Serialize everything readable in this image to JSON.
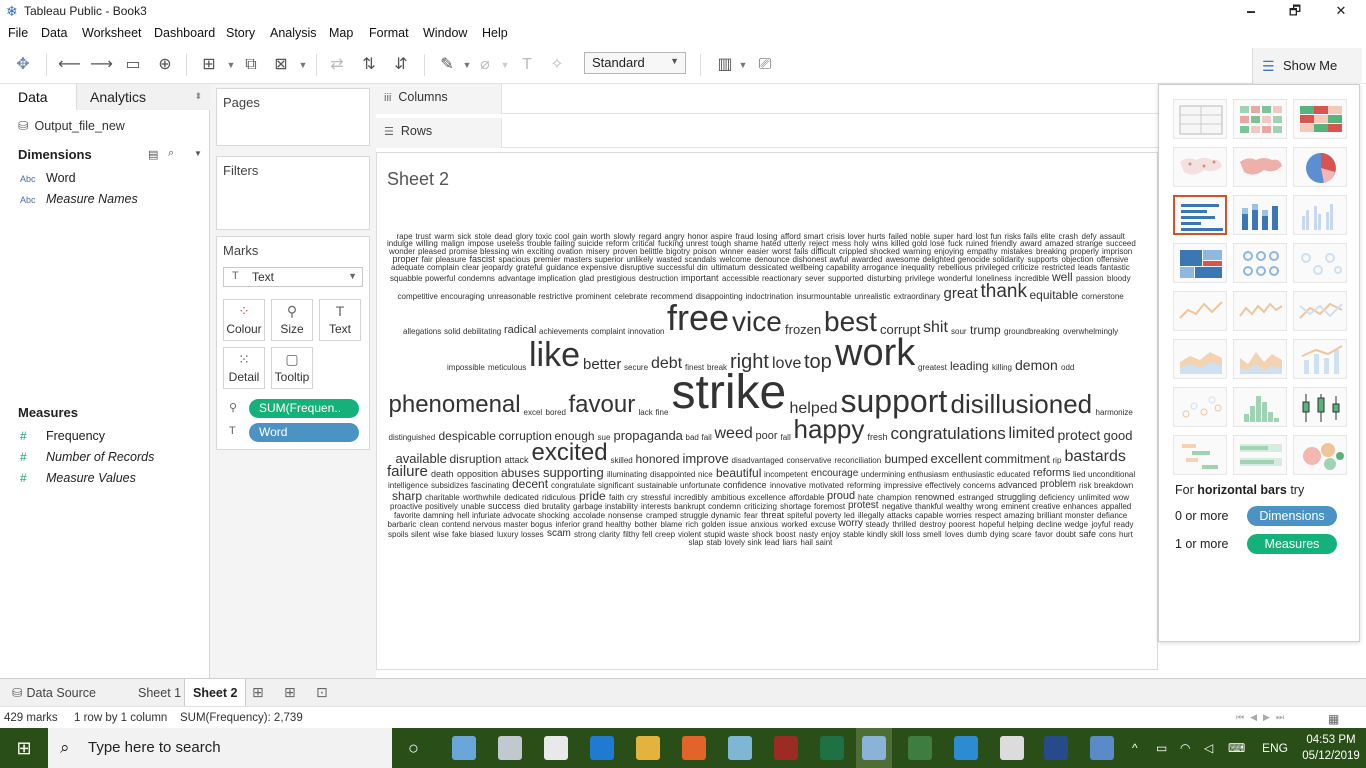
{
  "window": {
    "title": "Tableau Public - Book3",
    "minimize": "🗕",
    "maximize": "🗗",
    "close": "✕"
  },
  "menu": [
    "File",
    "Data",
    "Worksheet",
    "Dashboard",
    "Story",
    "Analysis",
    "Map",
    "Format",
    "Window",
    "Help"
  ],
  "toolbar": {
    "fit_mode": "Standard",
    "show_me_label": "Show Me"
  },
  "data_pane": {
    "tab_data": "Data",
    "tab_analytics": "Analytics",
    "datasource": "Output_file_new",
    "dimensions_header": "Dimensions",
    "dimensions": [
      {
        "type": "Abc",
        "name": "Word",
        "italic": false
      },
      {
        "type": "Abc",
        "name": "Measure Names",
        "italic": true
      }
    ],
    "measures_header": "Measures",
    "measures": [
      {
        "type": "#",
        "name": "Frequency",
        "italic": false
      },
      {
        "type": "#",
        "name": "Number of Records",
        "italic": true
      },
      {
        "type": "#",
        "name": "Measure Values",
        "italic": true
      }
    ]
  },
  "cards": {
    "pages": "Pages",
    "filters": "Filters",
    "marks": "Marks",
    "mark_type": "Text",
    "buttons": [
      {
        "icon": "color-icon",
        "label": "Colour"
      },
      {
        "icon": "size-icon",
        "label": "Size"
      },
      {
        "icon": "text-icon",
        "label": "Text"
      },
      {
        "icon": "detail-icon",
        "label": "Detail"
      },
      {
        "icon": "tooltip-icon",
        "label": "Tooltip"
      }
    ],
    "pills": [
      "SUM(Frequen..",
      "Word"
    ]
  },
  "shelves": {
    "columns": "Columns",
    "rows": "Rows"
  },
  "sheet": {
    "title": "Sheet 2"
  },
  "word_cloud": [
    [
      "rape",
      8
    ],
    [
      "trust",
      8
    ],
    [
      "warm",
      8
    ],
    [
      "sick",
      8
    ],
    [
      "stole",
      8
    ],
    [
      "dead",
      8
    ],
    [
      "glory",
      8
    ],
    [
      "toxic",
      8
    ],
    [
      "cool",
      8
    ],
    [
      "gain",
      8
    ],
    [
      "worth",
      8
    ],
    [
      "slowly",
      8
    ],
    [
      "regard",
      8
    ],
    [
      "angry",
      8
    ],
    [
      "honor",
      8
    ],
    [
      "aspire",
      8
    ],
    [
      "fraud",
      8
    ],
    [
      "losing",
      8
    ],
    [
      "afford",
      8
    ],
    [
      "smart",
      8
    ],
    [
      "crisis",
      8
    ],
    [
      "lover",
      8
    ],
    [
      "hurts",
      8
    ],
    [
      "failed",
      8
    ],
    [
      "noble",
      8
    ],
    [
      "super",
      8
    ],
    [
      "hard",
      8
    ],
    [
      "lost",
      8
    ],
    [
      "fun",
      8
    ],
    [
      "risks",
      8
    ],
    [
      "fails",
      8
    ],
    [
      "elite",
      8
    ],
    [
      "crash",
      8
    ],
    [
      "defy",
      8
    ],
    [
      "assault",
      8
    ],
    [
      "indulge",
      8
    ],
    [
      "willing",
      8
    ],
    [
      "malign",
      8
    ],
    [
      "impose",
      8
    ],
    [
      "useless",
      8
    ],
    [
      "trouble",
      8
    ],
    [
      "failing",
      8
    ],
    [
      "suicide",
      8
    ],
    [
      "reform",
      8
    ],
    [
      "critical",
      8
    ],
    [
      "fucking",
      8
    ],
    [
      "unrest",
      8
    ],
    [
      "tough",
      8
    ],
    [
      "shame",
      8
    ],
    [
      "hated",
      8
    ],
    [
      "utterly",
      8
    ],
    [
      "reject",
      8
    ],
    [
      "mess",
      8
    ],
    [
      "holy",
      8
    ],
    [
      "wins",
      8
    ],
    [
      "killed",
      8
    ],
    [
      "gold",
      8
    ],
    [
      "lose",
      8
    ],
    [
      "fuck",
      8
    ],
    [
      "ruined",
      8
    ],
    [
      "friendly",
      8
    ],
    [
      "award",
      8
    ],
    [
      "amazed",
      8
    ],
    [
      "strange",
      8
    ],
    [
      "succeed",
      8
    ],
    [
      "wonder",
      8
    ],
    [
      "pleased",
      8
    ],
    [
      "promise",
      8
    ],
    [
      "blessing",
      8
    ],
    [
      "win",
      8
    ],
    [
      "exciting",
      8
    ],
    [
      "ovation",
      8
    ],
    [
      "misery",
      8
    ],
    [
      "proven",
      8
    ],
    [
      "belittle",
      8
    ],
    [
      "bigotry",
      8
    ],
    [
      "poison",
      8
    ],
    [
      "winner",
      8
    ],
    [
      "easier",
      8
    ],
    [
      "worst",
      8
    ],
    [
      "fails",
      8
    ],
    [
      "difficult",
      8
    ],
    [
      "crippled",
      8
    ],
    [
      "shocked",
      8
    ],
    [
      "warning",
      8
    ],
    [
      "enjoying",
      8
    ],
    [
      "empathy",
      8
    ],
    [
      "mistakes",
      8
    ],
    [
      "breaking",
      8
    ],
    [
      "properly",
      8
    ],
    [
      "imprison",
      8
    ],
    [
      "proper",
      9
    ],
    [
      "fair",
      8
    ],
    [
      "pleasure",
      8
    ],
    [
      "fascist",
      9
    ],
    [
      "spacious",
      8
    ],
    [
      "premier",
      8
    ],
    [
      "masters",
      8
    ],
    [
      "superior",
      8
    ],
    [
      "unlikely",
      8
    ],
    [
      "wasted",
      8
    ],
    [
      "scandals",
      8
    ],
    [
      "welcome",
      8
    ],
    [
      "denounce",
      8
    ],
    [
      "dishonest",
      8
    ],
    [
      "awful",
      8
    ],
    [
      "awarded",
      8
    ],
    [
      "awesome",
      8
    ],
    [
      "delighted",
      8
    ],
    [
      "genocide",
      8
    ],
    [
      "solidarity",
      8
    ],
    [
      "supports",
      8
    ],
    [
      "objection",
      8
    ],
    [
      "offensive",
      8
    ],
    [
      "adequate",
      8
    ],
    [
      "complain",
      8
    ],
    [
      "clear",
      8
    ],
    [
      "jeopardy",
      8
    ],
    [
      "grateful",
      8
    ],
    [
      "guidance",
      8
    ],
    [
      "expensive",
      8
    ],
    [
      "disruptive",
      8
    ],
    [
      "successful",
      8
    ],
    [
      "din",
      8
    ],
    [
      "ultimatum",
      8
    ],
    [
      "dessicated",
      8
    ],
    [
      "wellbeing",
      8
    ],
    [
      "capability",
      8
    ],
    [
      "arrogance",
      8
    ],
    [
      "inequality",
      8
    ],
    [
      "rebellious",
      8
    ],
    [
      "privileged",
      8
    ],
    [
      "criticize",
      8
    ],
    [
      "restricted",
      8
    ],
    [
      "leads",
      8
    ],
    [
      "fantastic",
      8
    ],
    [
      "squabble",
      8
    ],
    [
      "powerful",
      8
    ],
    [
      "condemns",
      8
    ],
    [
      "advantage",
      8
    ],
    [
      "implication",
      8
    ],
    [
      "glad",
      8
    ],
    [
      "prestigious",
      8
    ],
    [
      "destruction",
      8
    ],
    [
      "important",
      9
    ],
    [
      "accessible",
      8
    ],
    [
      "reactionary",
      8
    ],
    [
      "sever",
      8
    ],
    [
      "supported",
      8
    ],
    [
      "disturbing",
      8
    ],
    [
      "privilege",
      8
    ],
    [
      "wonderful",
      8
    ],
    [
      "loneliness",
      8
    ],
    [
      "incredible",
      8
    ],
    [
      "well",
      12
    ],
    [
      "passion",
      8
    ],
    [
      "bloody",
      8
    ],
    [
      "competitive",
      8
    ],
    [
      "encouraging",
      8
    ],
    [
      "unreasonable",
      8
    ],
    [
      "restrictive",
      8
    ],
    [
      "prominent",
      8
    ],
    [
      "celebrate",
      8
    ],
    [
      "recommend",
      8
    ],
    [
      "disappointing",
      8
    ],
    [
      "indoctrination",
      8
    ],
    [
      "insurmountable",
      8
    ],
    [
      "unrealistic",
      8
    ],
    [
      "extraordinary",
      8
    ],
    [
      "great",
      15
    ],
    [
      "thank",
      19
    ],
    [
      "equitable",
      12
    ],
    [
      "cornerstone",
      8
    ],
    [
      "allegations",
      8
    ],
    [
      "solid",
      8
    ],
    [
      "debilitating",
      8
    ],
    [
      "radical",
      11
    ],
    [
      "achievements",
      8
    ],
    [
      "complaint",
      8
    ],
    [
      "innovation",
      8
    ],
    [
      "free",
      36
    ],
    [
      "vice",
      28
    ],
    [
      "frozen",
      13
    ],
    [
      "best",
      28
    ],
    [
      "corrupt",
      13
    ],
    [
      "shit",
      16
    ],
    [
      "sour",
      8
    ],
    [
      "trump",
      12
    ],
    [
      "groundbreaking",
      8
    ],
    [
      "overwhelmingly",
      8
    ],
    [
      "impossible",
      8
    ],
    [
      "meticulous",
      8
    ],
    [
      "like",
      34
    ],
    [
      "better",
      15
    ],
    [
      "secure",
      8
    ],
    [
      "debt",
      16
    ],
    [
      "finest",
      8
    ],
    [
      "break",
      8
    ],
    [
      "right",
      20
    ],
    [
      "love",
      16
    ],
    [
      "top",
      20
    ],
    [
      "work",
      38
    ],
    [
      "greatest",
      8
    ],
    [
      "leading",
      12
    ],
    [
      "killing",
      8
    ],
    [
      "demon",
      14
    ],
    [
      "odd",
      8
    ],
    [
      "phenomenal",
      24
    ],
    [
      "excel",
      8
    ],
    [
      "bored",
      8
    ],
    [
      "favour",
      24
    ],
    [
      "lack",
      8
    ],
    [
      "fine",
      8
    ],
    [
      "strike",
      48
    ],
    [
      "helped",
      16
    ],
    [
      "support",
      32
    ],
    [
      "disillusioned",
      26
    ],
    [
      "harmonize",
      8
    ],
    [
      "distinguished",
      8
    ],
    [
      "despicable",
      12
    ],
    [
      "corruption",
      12
    ],
    [
      "enough",
      12
    ],
    [
      "sue",
      8
    ],
    [
      "propaganda",
      13
    ],
    [
      "bad",
      8
    ],
    [
      "fail",
      8
    ],
    [
      "weed",
      16
    ],
    [
      "poor",
      11
    ],
    [
      "fall",
      8
    ],
    [
      "happy",
      26
    ],
    [
      "fresh",
      9
    ],
    [
      "congratulations",
      17
    ],
    [
      "limited",
      16
    ],
    [
      "protect",
      14
    ],
    [
      "good",
      13
    ],
    [
      "available",
      13
    ],
    [
      "disruption",
      12
    ],
    [
      "attack",
      9
    ],
    [
      "excited",
      24
    ],
    [
      "skilled",
      8
    ],
    [
      "honored",
      12
    ],
    [
      "improve",
      13
    ],
    [
      "disadvantaged",
      8
    ],
    [
      "conservative",
      8
    ],
    [
      "reconciliation",
      8
    ],
    [
      "bumped",
      12
    ],
    [
      "excellent",
      13
    ],
    [
      "commitment",
      12
    ],
    [
      "rip",
      8
    ],
    [
      "bastards",
      16
    ],
    [
      "failure",
      15
    ],
    [
      "death",
      9
    ],
    [
      "opposition",
      9
    ],
    [
      "abuses",
      12
    ],
    [
      "supporting",
      13
    ],
    [
      "illuminating",
      8
    ],
    [
      "disappointed",
      8
    ],
    [
      "nice",
      8
    ],
    [
      "beautiful",
      12
    ],
    [
      "incompetent",
      8
    ],
    [
      "encourage",
      10
    ],
    [
      "undermining",
      8
    ],
    [
      "enthusiasm",
      8
    ],
    [
      "enthusiastic",
      8
    ],
    [
      "educated",
      8
    ],
    [
      "reforms",
      11
    ],
    [
      "lied",
      8
    ],
    [
      "unconditional",
      8
    ],
    [
      "intelligence",
      8
    ],
    [
      "subsidizes",
      8
    ],
    [
      "fascinating",
      8
    ],
    [
      "decent",
      12
    ],
    [
      "congratulate",
      8
    ],
    [
      "significant",
      8
    ],
    [
      "sustainable",
      8
    ],
    [
      "unfortunate",
      8
    ],
    [
      "confidence",
      9
    ],
    [
      "innovative",
      8
    ],
    [
      "motivated",
      8
    ],
    [
      "reforming",
      8
    ],
    [
      "impressive",
      8
    ],
    [
      "effectively",
      8
    ],
    [
      "concerns",
      8
    ],
    [
      "advanced",
      9
    ],
    [
      "problem",
      10
    ],
    [
      "risk",
      8
    ],
    [
      "breakdown",
      8
    ],
    [
      "sharp",
      12
    ],
    [
      "charitable",
      8
    ],
    [
      "worthwhile",
      8
    ],
    [
      "dedicated",
      8
    ],
    [
      "ridiculous",
      8
    ],
    [
      "pride",
      12
    ],
    [
      "faith",
      8
    ],
    [
      "cry",
      8
    ],
    [
      "stressful",
      8
    ],
    [
      "incredibly",
      8
    ],
    [
      "ambitious",
      8
    ],
    [
      "excellence",
      8
    ],
    [
      "affordable",
      8
    ],
    [
      "proud",
      11
    ],
    [
      "hate",
      8
    ],
    [
      "champion",
      8
    ],
    [
      "renowned",
      9
    ],
    [
      "estranged",
      8
    ],
    [
      "struggling",
      9
    ],
    [
      "deficiency",
      8
    ],
    [
      "unlimited",
      8
    ],
    [
      "wow",
      8
    ],
    [
      "proactive",
      8
    ],
    [
      "positively",
      8
    ],
    [
      "unable",
      8
    ],
    [
      "success",
      9
    ],
    [
      "died",
      8
    ],
    [
      "brutality",
      8
    ],
    [
      "garbage",
      8
    ],
    [
      "instability",
      8
    ],
    [
      "interests",
      8
    ],
    [
      "bankrupt",
      8
    ],
    [
      "condemn",
      8
    ],
    [
      "criticizing",
      8
    ],
    [
      "shortage",
      8
    ],
    [
      "foremost",
      8
    ],
    [
      "protest",
      10
    ],
    [
      "negative",
      8
    ],
    [
      "thankful",
      8
    ],
    [
      "wealthy",
      8
    ],
    [
      "wrong",
      8
    ],
    [
      "eminent",
      8
    ],
    [
      "creative",
      8
    ],
    [
      "enhances",
      8
    ],
    [
      "appalled",
      8
    ],
    [
      "favorite",
      8
    ],
    [
      "damning",
      8
    ],
    [
      "hell",
      8
    ],
    [
      "infuriate",
      8
    ],
    [
      "advocate",
      8
    ],
    [
      "shocking",
      8
    ],
    [
      "accolade",
      8
    ],
    [
      "nonsense",
      8
    ],
    [
      "cramped",
      8
    ],
    [
      "struggle",
      8
    ],
    [
      "dynamic",
      8
    ],
    [
      "fear",
      8
    ],
    [
      "threat",
      9
    ],
    [
      "spiteful",
      8
    ],
    [
      "poverty",
      8
    ],
    [
      "led",
      8
    ],
    [
      "illegally",
      8
    ],
    [
      "attacks",
      8
    ],
    [
      "capable",
      8
    ],
    [
      "worries",
      8
    ],
    [
      "respect",
      8
    ],
    [
      "amazing",
      8
    ],
    [
      "brilliant",
      8
    ],
    [
      "monster",
      8
    ],
    [
      "defiance",
      8
    ],
    [
      "barbaric",
      8
    ],
    [
      "clean",
      8
    ],
    [
      "contend",
      8
    ],
    [
      "nervous",
      8
    ],
    [
      "master",
      8
    ],
    [
      "bogus",
      8
    ],
    [
      "inferior",
      8
    ],
    [
      "grand",
      8
    ],
    [
      "healthy",
      8
    ],
    [
      "bother",
      8
    ],
    [
      "blame",
      8
    ],
    [
      "rich",
      8
    ],
    [
      "golden",
      8
    ],
    [
      "issue",
      8
    ],
    [
      "anxious",
      8
    ],
    [
      "worked",
      8
    ],
    [
      "excuse",
      8
    ],
    [
      "worry",
      10
    ],
    [
      "steady",
      8
    ],
    [
      "thrilled",
      8
    ],
    [
      "destroy",
      8
    ],
    [
      "poorest",
      8
    ],
    [
      "hopeful",
      8
    ],
    [
      "helping",
      8
    ],
    [
      "decline",
      8
    ],
    [
      "wedge",
      8
    ],
    [
      "joyful",
      8
    ],
    [
      "ready",
      8
    ],
    [
      "spoils",
      8
    ],
    [
      "silent",
      8
    ],
    [
      "wise",
      8
    ],
    [
      "fake",
      8
    ],
    [
      "biased",
      8
    ],
    [
      "luxury",
      8
    ],
    [
      "losses",
      8
    ],
    [
      "scam",
      10
    ],
    [
      "strong",
      8
    ],
    [
      "clarity",
      8
    ],
    [
      "filthy",
      8
    ],
    [
      "fell",
      8
    ],
    [
      "creep",
      8
    ],
    [
      "violent",
      8
    ],
    [
      "stupid",
      8
    ],
    [
      "waste",
      8
    ],
    [
      "shock",
      8
    ],
    [
      "boost",
      8
    ],
    [
      "nasty",
      8
    ],
    [
      "enjoy",
      8
    ],
    [
      "stable",
      8
    ],
    [
      "kindly",
      8
    ],
    [
      "skill",
      8
    ],
    [
      "loss",
      8
    ],
    [
      "smell",
      8
    ],
    [
      "loves",
      8
    ],
    [
      "dumb",
      8
    ],
    [
      "dying",
      8
    ],
    [
      "scare",
      8
    ],
    [
      "favor",
      8
    ],
    [
      "doubt",
      8
    ],
    [
      "safe",
      9
    ],
    [
      "cons",
      8
    ],
    [
      "hurt",
      8
    ],
    [
      "slap",
      8
    ],
    [
      "stab",
      8
    ],
    [
      "lovely",
      8
    ],
    [
      "sink",
      8
    ],
    [
      "lead",
      8
    ],
    [
      "liars",
      8
    ],
    [
      "hail",
      8
    ],
    [
      "saint",
      8
    ]
  ],
  "show_me": {
    "hint_prefix": "For",
    "hint_bold": "horizontal bars",
    "hint_suffix": "try",
    "req1_count": "0 or more",
    "req1_badge": "Dimensions",
    "req2_count": "1 or more",
    "req2_badge": "Measures",
    "charts": [
      "text-table",
      "heat-map",
      "highlight-table",
      "symbol-map",
      "filled-map",
      "pie-chart",
      "horizontal-bars",
      "stacked-bars",
      "side-by-side-bars",
      "treemap",
      "circle-views",
      "side-by-side-circles",
      "continuous-lines",
      "discrete-lines",
      "dual-lines",
      "area-continuous",
      "area-discrete",
      "dual-combination",
      "scatter-plot",
      "histogram",
      "box-and-whisker",
      "gantt-chart",
      "bullet-graph",
      "packed-bubbles"
    ],
    "selected": "horizontal-bars"
  },
  "tabs": {
    "datasource": "Data Source",
    "sheet1": "Sheet 1",
    "sheet2": "Sheet 2"
  },
  "status": {
    "marks": "429 marks",
    "rows_cols": "1 row by 1 column",
    "sum": "SUM(Frequency): 2,739"
  },
  "taskbar": {
    "search_placeholder": "Type here to search",
    "language": "ENG",
    "time": "04:53 PM",
    "date": "05/12/2019"
  }
}
